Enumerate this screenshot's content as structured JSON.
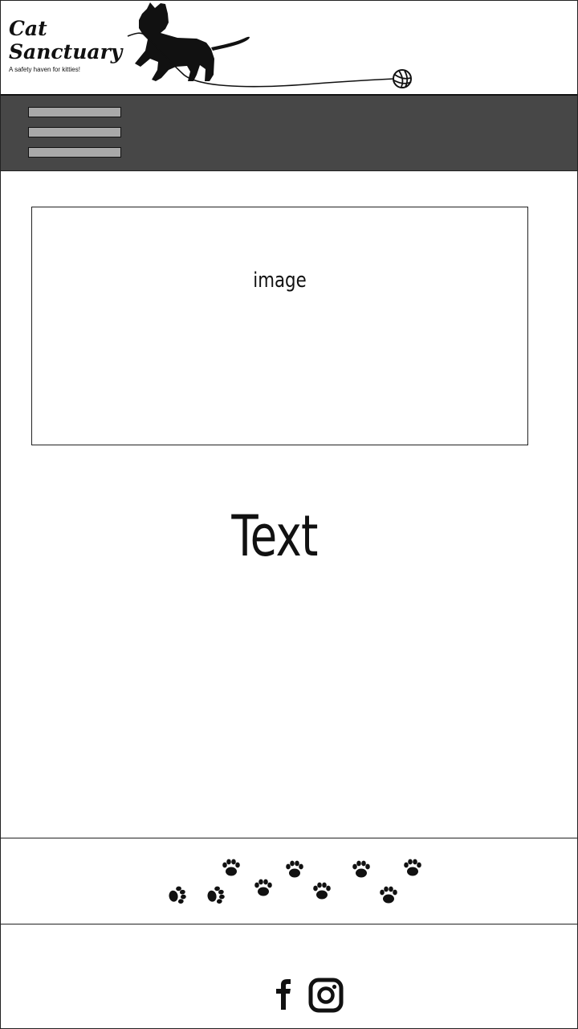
{
  "header": {
    "title": "Cat\nSanctuary",
    "tagline": "A safety haven for kitties!"
  },
  "nav": {
    "menu_icon": "hamburger-menu-icon"
  },
  "main": {
    "image_placeholder": "image",
    "text": "Text"
  },
  "footer": {
    "decoration_icon": "paw-prints-icon",
    "social": [
      {
        "icon": "facebook-icon"
      },
      {
        "icon": "instagram-icon"
      }
    ]
  },
  "colors": {
    "navbar": "#474747",
    "menu_bar": "#a9a9a9",
    "text": "#111111",
    "background": "#ffffff"
  }
}
